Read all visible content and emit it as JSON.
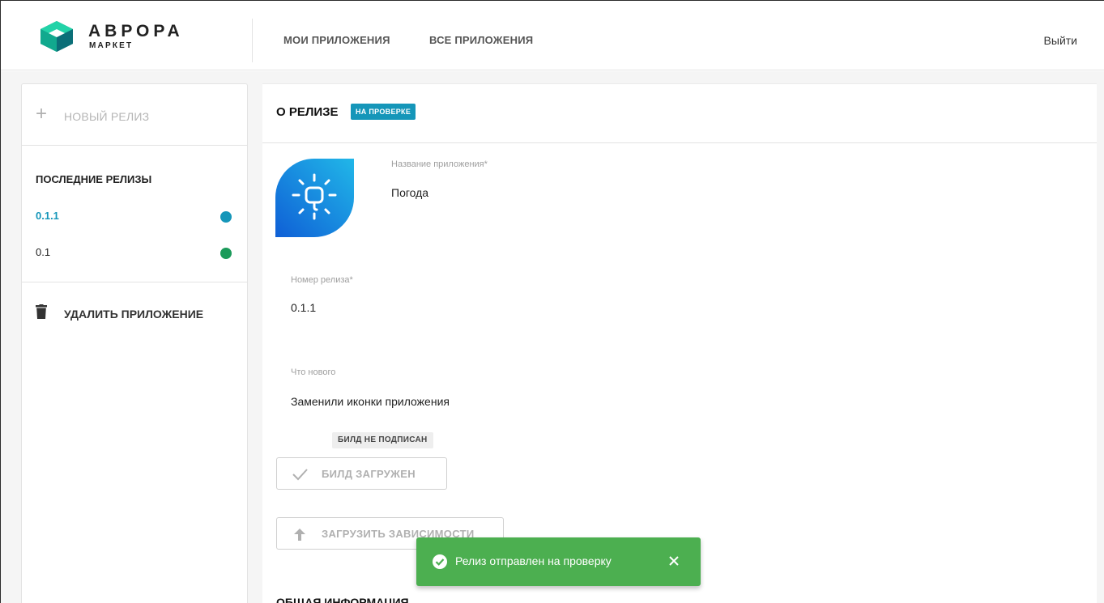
{
  "header": {
    "logo_title": "АВРОРА",
    "logo_sub": "МАРКЕТ",
    "nav": [
      {
        "label": "МОИ ПРИЛОЖЕНИЯ"
      },
      {
        "label": "ВСЕ ПРИЛОЖЕНИЯ"
      }
    ],
    "logout": "Выйти"
  },
  "sidebar": {
    "new_release": "НОВЫЙ РЕЛИЗ",
    "recent_title": "ПОСЛЕДНИЕ РЕЛИЗЫ",
    "releases": [
      {
        "version": "0.1.1",
        "status_color": "#1596b9"
      },
      {
        "version": "0.1",
        "status_color": "#1b9a5a"
      }
    ],
    "delete_app": "УДАЛИТЬ ПРИЛОЖЕНИЕ"
  },
  "main": {
    "title": "О РЕЛИЗЕ",
    "status_badge": "НА ПРОВЕРКЕ",
    "fields": {
      "app_name_label": "Название приложения*",
      "app_name_value": "Погода",
      "release_label": "Номер релиза*",
      "release_value": "0.1.1",
      "whats_new_label": "Что нового",
      "whats_new_value": "Заменили иконки приложения"
    },
    "unsigned_badge": "БИЛД НЕ ПОДПИСАН",
    "build_button": "БИЛД ЗАГРУЖЕН",
    "deps_button": "ЗАГРУЗИТЬ ЗАВИСИМОСТИ",
    "general_info": "ОБЩАЯ ИНФОРМАЦИЯ"
  },
  "toast": {
    "message": "Релиз отправлен на проверку"
  },
  "colors": {
    "accent": "#1596b9",
    "success": "#4caf50",
    "status_green": "#1b9a5a"
  }
}
